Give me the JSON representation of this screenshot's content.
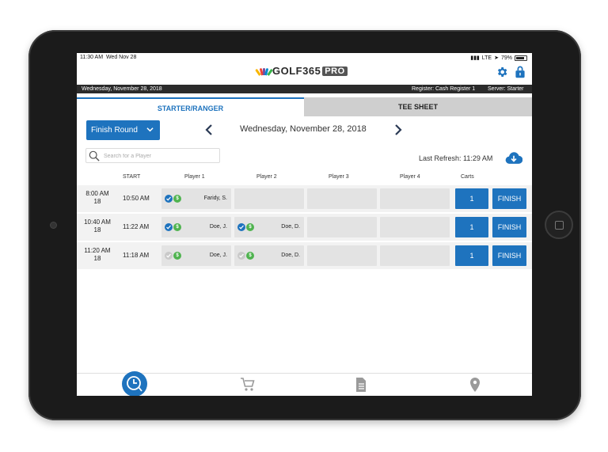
{
  "status": {
    "time": "11:30 AM",
    "day": "Wed Nov 28",
    "network": "LTE",
    "battery": "79%"
  },
  "app": {
    "logo_text": "GOLF365",
    "logo_pro": "PRO"
  },
  "infobar": {
    "date": "Wednesday, November 28, 2018",
    "register": "Register: Cash Register 1",
    "server": "Server: Starter"
  },
  "tabs": [
    {
      "label": "STARTER/RANGER",
      "active": true
    },
    {
      "label": "TEE SHEET",
      "active": false
    }
  ],
  "toolbar": {
    "dropdown_label": "Finish Round",
    "current_date": "Wednesday, November 28, 2018"
  },
  "search": {
    "placeholder": "Search for a Player"
  },
  "refresh": {
    "label": "Last Refresh: 11:29 AM"
  },
  "table": {
    "headers": {
      "start": "START",
      "p1": "Player 1",
      "p2": "Player 2",
      "p3": "Player 3",
      "p4": "Player 4",
      "carts": "Carts"
    },
    "rows": [
      {
        "tee_time": "8:00 AM",
        "holes": "18",
        "start": "10:50 AM",
        "p1": "Faridy, S.",
        "p2": "",
        "carts": "1",
        "finish": "FINISH"
      },
      {
        "tee_time": "10:40 AM",
        "holes": "18",
        "start": "11:22 AM",
        "p1": "Doe, J.",
        "p2": "Doe, D.",
        "carts": "1",
        "finish": "FINISH"
      },
      {
        "tee_time": "11:20 AM",
        "holes": "18",
        "start": "11:18 AM",
        "p1": "Doe, J.",
        "p2": "Doe, D.",
        "carts": "1",
        "finish": "FINISH"
      }
    ]
  },
  "colors": {
    "accent": "#1e73be",
    "dark_bar": "#2b2b2b",
    "paid": "#4fb34f"
  },
  "icons": {
    "dollar": "$"
  },
  "bottom_nav": [
    "tee-time-icon",
    "cart-icon",
    "document-icon",
    "location-pin-icon"
  ]
}
